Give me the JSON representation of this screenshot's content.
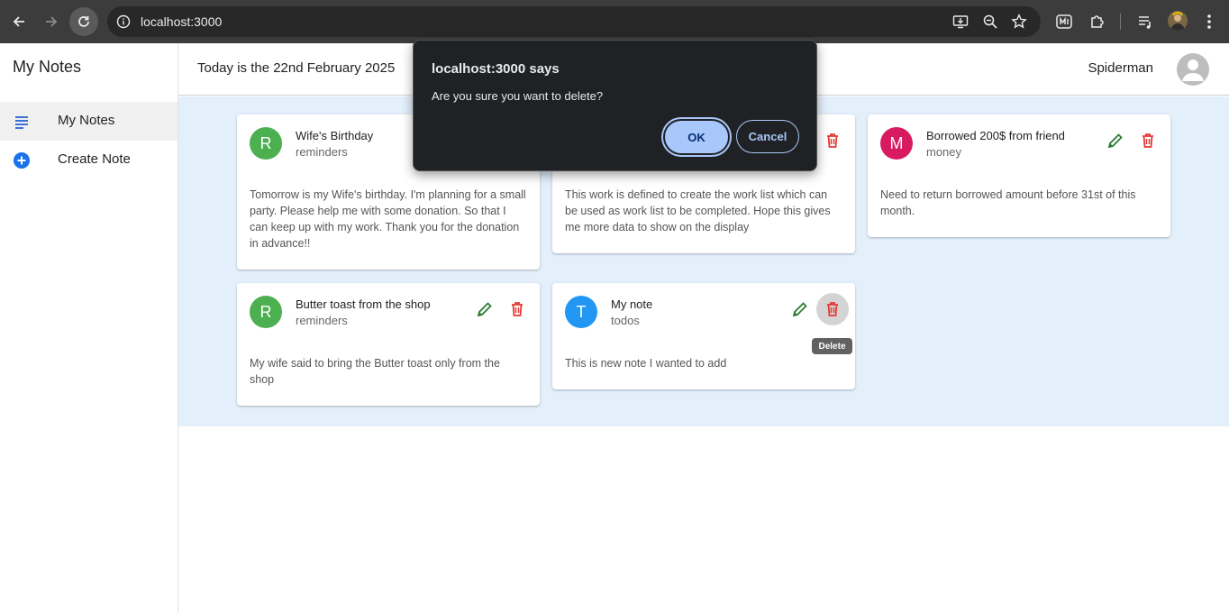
{
  "browser": {
    "url": "localhost:3000"
  },
  "sidebar": {
    "brand": "My Notes",
    "items": [
      {
        "label": "My Notes",
        "icon": "notes-list-icon",
        "active": true
      },
      {
        "label": "Create Note",
        "icon": "add-circle-icon",
        "active": false
      }
    ]
  },
  "header": {
    "date": "Today is the 22nd February 2025",
    "user": "Spiderman"
  },
  "notes": [
    {
      "initial": "R",
      "title": "Wife's Birthday",
      "category": "reminders",
      "body": "Tomorrow is my Wife's birthday. I'm planning for a small party. Please help me with some donation. So that I can keep up with my work. Thank you for the donation in advance!!",
      "color": "#4caf50"
    },
    {
      "initial": "",
      "title": "",
      "category": "",
      "body": "This work is defined to create the work list which can be used as work list to be completed. Hope this gives me more data to show on the display",
      "color": ""
    },
    {
      "initial": "M",
      "title": "Borrowed 200$ from friend",
      "category": "money",
      "body": "Need to return borrowed amount before 31st of this month.",
      "color": "#d81b60"
    },
    {
      "initial": "R",
      "title": "Butter toast from the shop",
      "category": "reminders",
      "body": "My wife said to bring the Butter toast only from the shop",
      "color": "#4caf50"
    },
    {
      "initial": "T",
      "title": "My note",
      "category": "todos",
      "body": "This is new note I wanted to add",
      "color": "#2196f3"
    }
  ],
  "tooltip": "Delete",
  "dialog": {
    "title": "localhost:3000 says",
    "message": "Are you sure you want to delete?",
    "ok": "OK",
    "cancel": "Cancel"
  },
  "colors": {
    "edit": "#2e7d32",
    "delete": "#e53935",
    "main_bg": "#e3f0fc"
  }
}
